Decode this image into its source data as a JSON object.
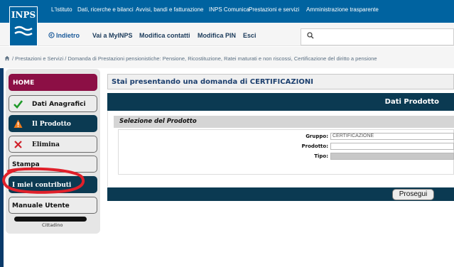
{
  "top_links": [
    "L'Istituto",
    "Dati, ricerche e bilanci",
    "Avvisi, bandi e fatturazione",
    "INPS Comunica",
    "Prestazioni e servizi",
    "Amministrazione trasparente"
  ],
  "logo_text": "INPS",
  "nav": {
    "indietro": "Indietro",
    "vai": "Vai a MyINPS",
    "modifica_contatti": "Modifica contatti",
    "modifica_pin": "Modifica PIN",
    "esci": "Esci"
  },
  "search": {
    "placeholder": ""
  },
  "breadcrumb": "/  Prestazioni e Servizi  /  Domanda di Prestazioni pensionistiche: Pensione, Ricostituzione, Ratei maturati e non riscossi, Certificazione del diritto a pensione",
  "sidebar": {
    "home": "HOME",
    "dati_anagrafici": "Dati Anagrafici",
    "il_prodotto": "Il Prodotto",
    "elimina": "Elimina",
    "stampa": "Stampa",
    "miei_contributi": "I miei contributi",
    "manuale": "Manuale Utente",
    "user_role": "Cittadino"
  },
  "main": {
    "title": "Stai presentando una domanda di CERTIFICAZIONI",
    "product_header": "Dati Prodotto",
    "selection_header": "Selezione del Prodotto",
    "gruppo_label": "Gruppo:",
    "gruppo_value": "CERTIFICAZIONE",
    "prodotto_label": "Prodotto:",
    "prodotto_value": "",
    "tipo_label": "Tipo:",
    "tipo_value": "",
    "prosegui": "Prosegui"
  },
  "colors": {
    "brand_blue": "#0063a0",
    "dark_teal": "#0b3a52",
    "home_magenta": "#8c0f45",
    "annotation_red": "#e0202a"
  }
}
